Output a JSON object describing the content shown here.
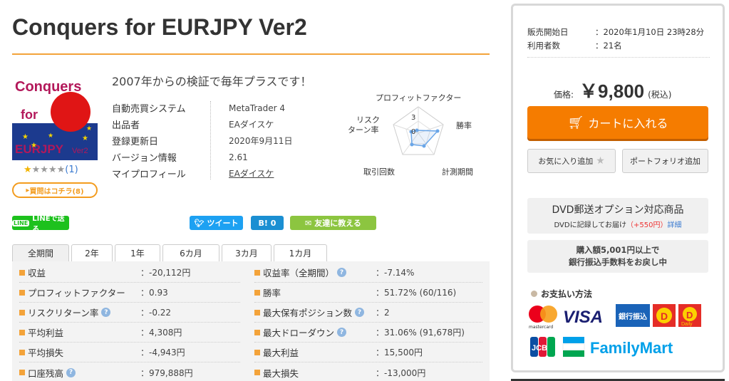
{
  "page": {
    "title": "Conquers for EURJPY Ver2",
    "catch": "2007年からの検証で毎年プラスです！"
  },
  "product_image": {
    "text_line1": "Conquers",
    "text_line2": "for",
    "text_line3": "EURJPY",
    "text_line4": "Ver2"
  },
  "rating": {
    "stars_filled": 1,
    "stars_total": 5,
    "count": "(1)"
  },
  "buy_link": "買問はコチラ(8)",
  "info": [
    {
      "key": "自動売買システム",
      "value": "MetaTrader 4"
    },
    {
      "key": "出品者",
      "value": "EAダイスケ"
    },
    {
      "key": "登録更新日",
      "value": "2020年9月11日"
    },
    {
      "key": "バージョン情報",
      "value": "2.61"
    },
    {
      "key": "マイプロフィール",
      "value": "EAダイスケ"
    }
  ],
  "radar": {
    "labels": [
      "プロフィットファクター",
      "勝率",
      "計測期間",
      "取引回数",
      "リスク\nターン率"
    ],
    "label_risk_1": "リスク",
    "label_risk_2": "ターン率",
    "tick_3": "3",
    "tick_0": "0"
  },
  "social": {
    "line": "LINEで送る",
    "tweet": "ツイート",
    "hatena": "B! 0",
    "tell": "友達に教える"
  },
  "tabs": [
    "全期間",
    "2年",
    "1年",
    "6カ月",
    "3カ月",
    "1カ月"
  ],
  "stats_left": [
    {
      "key": "収益",
      "value": "：-20,112円",
      "help": false
    },
    {
      "key": "プロフィットファクター",
      "value": "：0.93",
      "help": false
    },
    {
      "key": "リスクリターン率",
      "value": "：-0.22",
      "help": true
    },
    {
      "key": "平均利益",
      "value": "：4,308円",
      "help": false
    },
    {
      "key": "平均損失",
      "value": "：-4,943円",
      "help": false
    },
    {
      "key": "口座残高",
      "value": "：979,888円",
      "help": true
    }
  ],
  "stats_right": [
    {
      "key": "収益率（全期間）",
      "value": "：-7.14%",
      "help": true
    },
    {
      "key": "勝率",
      "value": "：51.72% (60/116)",
      "help": false
    },
    {
      "key": "最大保有ポジション数",
      "value": "：2",
      "help": true
    },
    {
      "key": "最大ドローダウン",
      "value": "：31.06% (91,678円)",
      "help": true
    },
    {
      "key": "最大利益",
      "value": "：15,500円",
      "help": false
    },
    {
      "key": "最大損失",
      "value": "：-13,000円",
      "help": false
    }
  ],
  "sidebar": {
    "sale_start_label": "販売開始日",
    "sale_start_value": "：2020年1月10日 23時28分",
    "users_label": "利用者数",
    "users_value": "：21名",
    "price_label": "価格:",
    "price_amount": "￥9,800",
    "price_tax": "(税込)",
    "cart_label": "カートに入れる",
    "fav_label": "お気に入り追加",
    "portfolio_label": "ポートフォリオ追加",
    "dvd_title": "DVD郵送オプション対応商品",
    "dvd_text": "DVDに記録してお届け",
    "dvd_price": "（+550円）",
    "dvd_detail": "詳細",
    "bank_line1": "購入額5,001円以上で",
    "bank_line2": "銀行振込手数料をお戻し中",
    "payment_header": "お支払い方法",
    "visa": "VISA",
    "bank_transfer": "銀行振込",
    "mastercard": "mastercard",
    "familymart": "FamilyMart",
    "jcb": "JCB",
    "daily": "Daily"
  },
  "colors": {
    "accent_orange": "#f3a33a",
    "cart_orange": "#f57c00",
    "line_green": "#1dc11d",
    "twitter_blue": "#1da1f2"
  }
}
